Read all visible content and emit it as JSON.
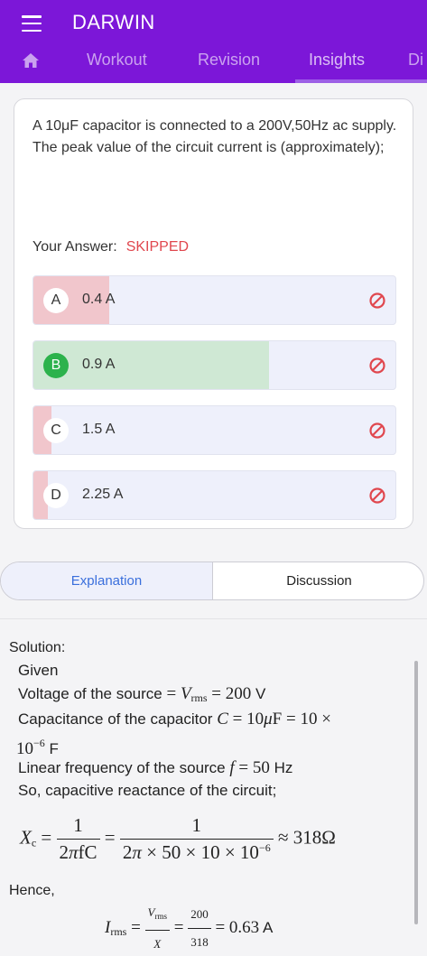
{
  "app": {
    "title": "DARWIN"
  },
  "tabs": [
    {
      "label": "Workout"
    },
    {
      "label": "Revision"
    },
    {
      "label": "Insights"
    },
    {
      "label": "Di"
    }
  ],
  "question": {
    "text": "A 10μF capacitor is connected to a 200V,50Hz ac supply. The peak value of the circuit current is (approximately);"
  },
  "answer": {
    "label": "Your Answer:",
    "value": "SKIPPED"
  },
  "options": [
    {
      "letter": "A",
      "text": "0.4 A",
      "response_share": 0.21,
      "fill_color": "#f1c6cc",
      "correct": false
    },
    {
      "letter": "B",
      "text": "0.9 A",
      "response_share": 0.65,
      "fill_color": "#cfe8d4",
      "correct": true
    },
    {
      "letter": "C",
      "text": "1.5 A",
      "response_share": 0.05,
      "fill_color": "#f1c6cc",
      "correct": false
    },
    {
      "letter": "D",
      "text": "2.25 A",
      "response_share": 0.04,
      "fill_color": "#f1c6cc",
      "correct": false
    }
  ],
  "segments": {
    "explanation": "Explanation",
    "discussion": "Discussion"
  },
  "solution": {
    "title": "Solution:",
    "given": "Given",
    "line1_prefix": "Voltage of the source",
    "line1_unit": "V",
    "line2_prefix": "Capacitance of the capacitor",
    "line2_unit": "F",
    "line3_prefix": "Linear frequency of the source",
    "line3_unit": "Hz",
    "line4": "So, capacitive reactance of the circuit;",
    "hence": "Hence,",
    "last_unit": "A"
  },
  "colors": {
    "brand": "#7c17d8",
    "wrong": "#e0474e",
    "correct": "#2cb24c",
    "link": "#3a6fdc"
  }
}
